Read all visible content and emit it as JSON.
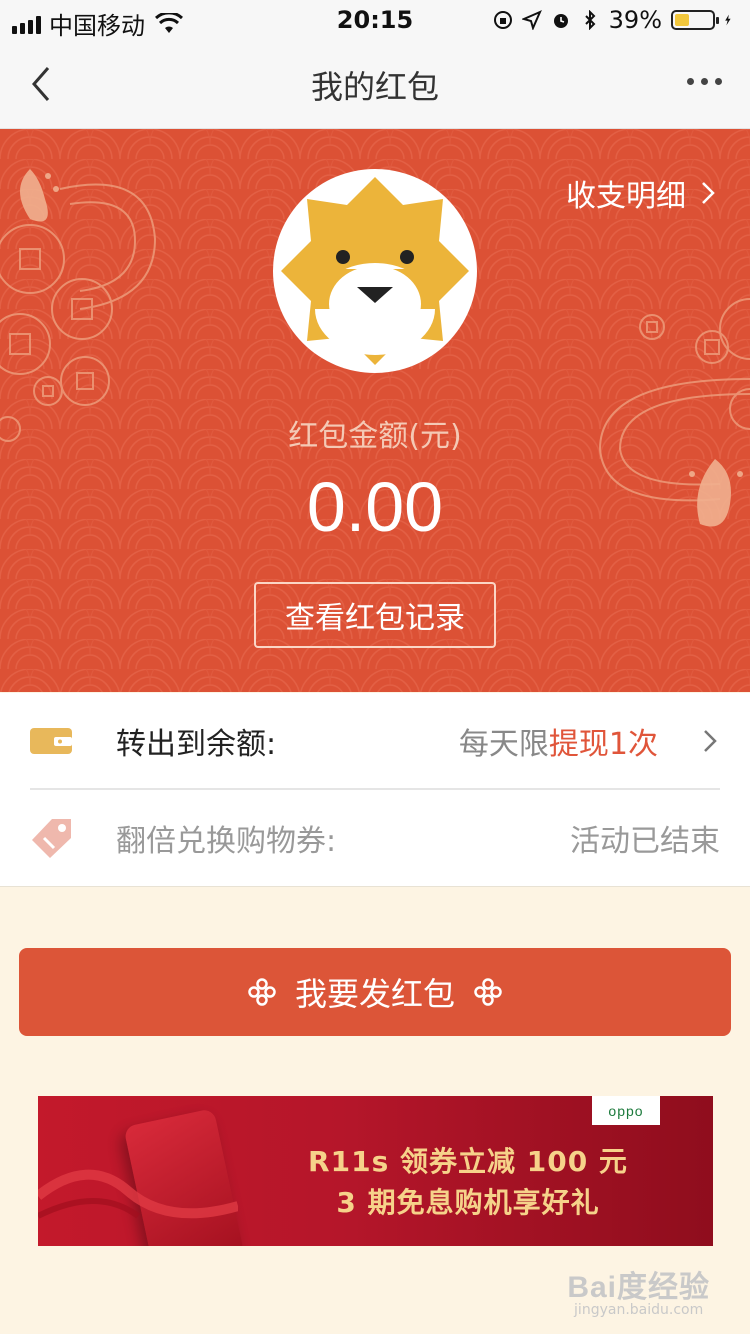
{
  "status_bar": {
    "carrier": "中国移动",
    "time": "20:15",
    "battery": "39%",
    "battery_level": 0.39,
    "icons": [
      "signal-icon",
      "wifi-icon",
      "rotation-lock-icon",
      "location-icon",
      "alarm-icon",
      "bluetooth-icon",
      "battery-icon",
      "charging-icon"
    ]
  },
  "nav": {
    "title": "我的红包",
    "back_icon": "chevron-left-icon",
    "more_icon": "more-dots-icon"
  },
  "hero": {
    "detail_link": "收支明细",
    "amount_label": "红包金额(元)",
    "amount": "0.00",
    "record_button": "查看红包记录"
  },
  "list": {
    "transfer": {
      "label": "转出到余额:",
      "value_prefix": "每天限",
      "value_highlight": "提现1次",
      "icon": "wallet-icon"
    },
    "coupon": {
      "label": "翻倍兑换购物券:",
      "value": "活动已结束",
      "icon": "tag-icon"
    }
  },
  "send_button": "我要发红包",
  "banner": {
    "brand": "oppo",
    "line1": "R11s 领券立减 100 元",
    "line2": "3 期免息购机享好礼"
  },
  "watermark": {
    "main": "Bai度经验",
    "sub": "jingyan.baidu.com"
  },
  "colors": {
    "primary_red": "#dc5135",
    "highlight": "#e0553a",
    "page_bg": "#fdf4e3",
    "banner_text": "#f6d28a"
  }
}
